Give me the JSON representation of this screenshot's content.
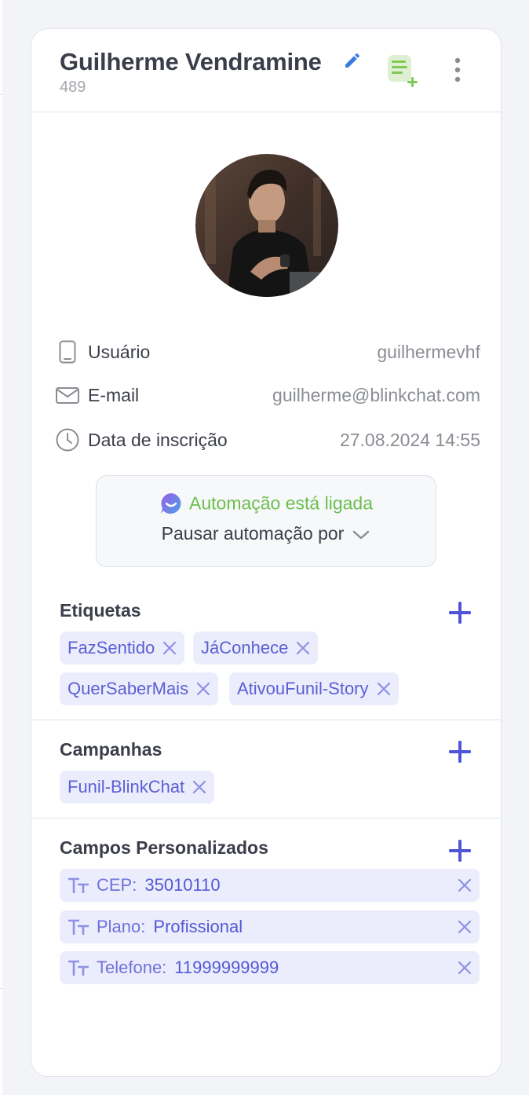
{
  "contact": {
    "name": "Guilherme Vendramine",
    "id": "489"
  },
  "info": {
    "username_label": "Usuário",
    "username_value": "guilhermevhf",
    "email_label": "E-mail",
    "email_value": "guilherme@blinkchat.com",
    "signup_label": "Data de inscrição",
    "signup_value": "27.08.2024 14:55"
  },
  "automation": {
    "status": "Automação está ligada",
    "pause_label": "Pausar automação por"
  },
  "tags": {
    "title": "Etiquetas",
    "items": [
      "FazSentido",
      "JáConhece",
      "QuerSaberMais",
      "AtivouFunil-Story"
    ]
  },
  "campaigns": {
    "title": "Campanhas",
    "items": [
      "Funil-BlinkChat"
    ]
  },
  "custom_fields": {
    "title": "Campos Personalizados",
    "items": [
      {
        "name": "CEP:",
        "value": "35010110"
      },
      {
        "name": "Plano:",
        "value": "Profissional"
      },
      {
        "name": "Telefone:",
        "value": "11999999999"
      }
    ]
  },
  "colors": {
    "accent": "#4f55d9",
    "tag_bg": "#ecedfc",
    "automation_on": "#6cbf4d",
    "note_icon": "#7fc957"
  },
  "icons": {
    "edit": "pencil-icon",
    "add_note": "note-add-icon",
    "more": "more-vertical-icon",
    "username": "phone-icon",
    "email": "mail-icon",
    "signup": "clock-icon",
    "automation": "chat-bubble-logo-icon",
    "add": "plus-icon",
    "remove": "close-icon",
    "field_type": "text-type-icon"
  }
}
